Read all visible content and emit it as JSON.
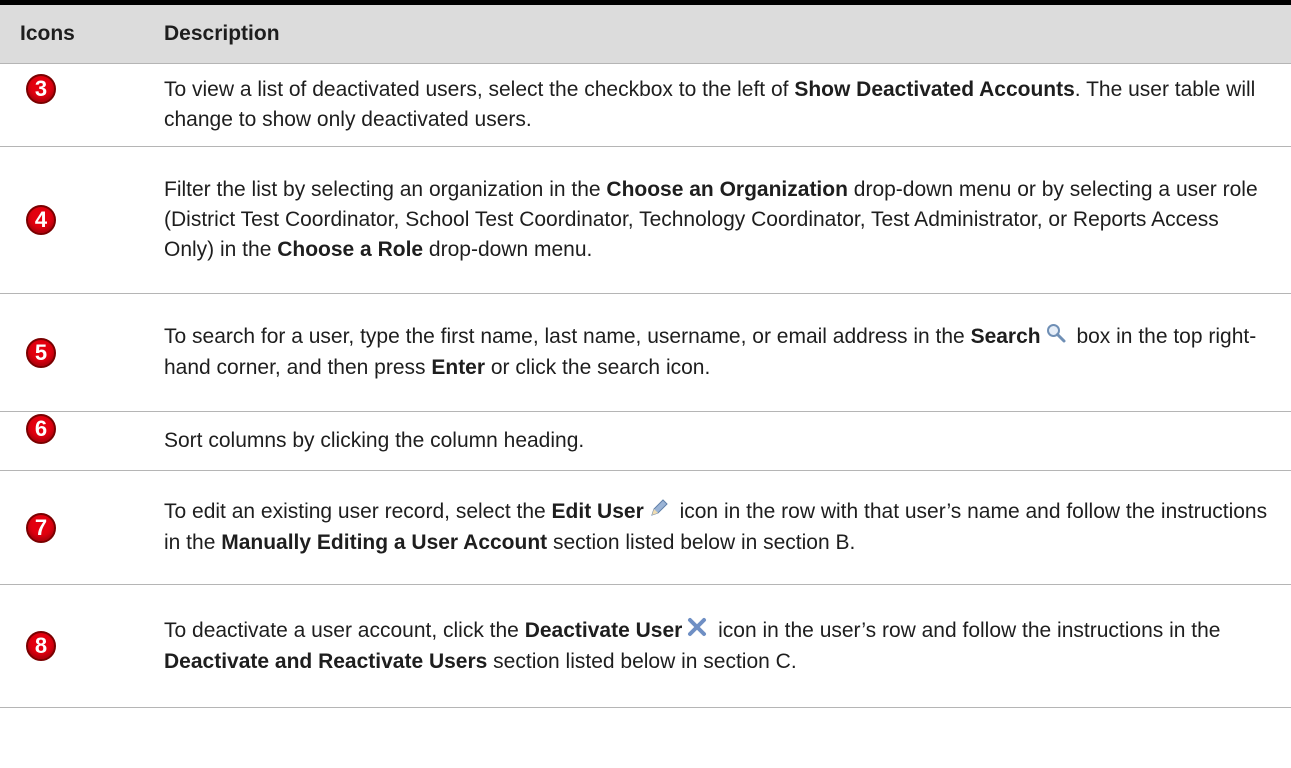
{
  "header": {
    "icons_label": "Icons",
    "description_label": "Description"
  },
  "rows": [
    {
      "badge": "3",
      "parts": [
        "To view a list of deactivated users, select the checkbox to the left of ",
        "Show Deactivated Accounts",
        ". The user table will change to show only deactivated users."
      ]
    },
    {
      "badge": "4",
      "parts": [
        "Filter the list by selecting an organization in the ",
        "Choose an Organization",
        " drop-down menu or by selecting a user role (District Test Coordinator, School Test Coordinator, Technology Coordinator, Test Administrator, or Reports Access Only) in the ",
        "Choose a Role",
        " drop-down menu."
      ]
    },
    {
      "badge": "5",
      "parts": [
        "To search for a user, type the first name, last name, username, or email address in the ",
        "Search",
        " box in the top right-hand corner, and then press ",
        "Enter",
        " or click the search icon."
      ]
    },
    {
      "badge": "6",
      "parts": [
        "Sort columns by clicking the column heading."
      ]
    },
    {
      "badge": "7",
      "parts": [
        "To edit an existing user record, select the ",
        "Edit User",
        " icon in the row with that user’s name and follow the instructions in the ",
        "Manually Editing a User Account",
        " section listed below in section B."
      ]
    },
    {
      "badge": "8",
      "parts": [
        "To deactivate a user account, click the ",
        "Deactivate User",
        " icon in the user’s row and follow the instructions in the ",
        "Deactivate and Reactivate Users",
        " section listed below in section C."
      ]
    }
  ],
  "icons": {
    "badge_color": "#e3000f",
    "search": "magnifier-icon",
    "edit": "pencil-icon",
    "deactivate": "x-icon"
  }
}
